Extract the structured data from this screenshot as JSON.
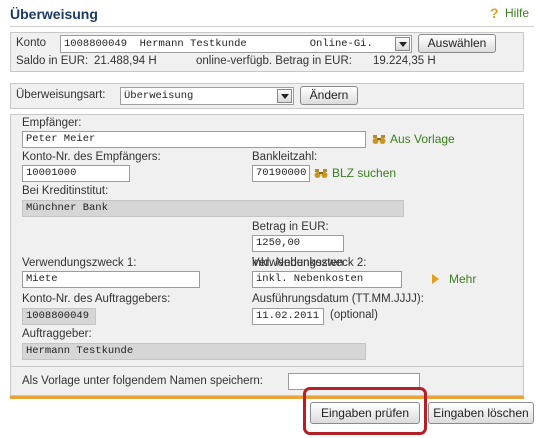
{
  "header": {
    "title": "Überweisung",
    "help_label": "Hilfe"
  },
  "account": {
    "label": "Konto",
    "select_value": "1008800049  Hermann Testkunde          Online-Gi.",
    "select_button": "Auswählen",
    "saldo_label": "Saldo in EUR:",
    "saldo_value": "21.488,94 H",
    "available_label": "online-verfügb. Betrag in EUR:",
    "available_value": "19.224,35 H"
  },
  "transfer_type": {
    "label": "Überweisungsart:",
    "value": "Überweisung",
    "change_button": "Ändern"
  },
  "form": {
    "recipient_label": "Empfänger:",
    "recipient_value": "Peter Meier",
    "template_link": "Aus Vorlage",
    "recipient_account_label": "Konto-Nr. des Empfängers:",
    "recipient_account_value": "10001000",
    "bank_code_label": "Bankleitzahl:",
    "bank_code_value": "70190000",
    "bank_code_search": "BLZ suchen",
    "institute_label": "Bei Kreditinstitut:",
    "institute_value": "Münchner Bank",
    "amount_label": "Betrag in EUR:",
    "amount_value": "1250,00",
    "purpose1_label": "Verwendungszweck 1:",
    "purpose1_value": "Miete",
    "purpose2_label": "Verwendungszweck 2:",
    "purpose2_value": "inkl. Nebenkosten",
    "more_link": "Mehr",
    "sender_account_label": "Konto-Nr. des Auftraggebers:",
    "sender_account_value": "1008800049",
    "execution_date_label": "Ausführungsdatum (TT.MM.JJJJ):",
    "execution_date_value": "11.02.2011",
    "optional_label": "(optional)",
    "sender_label": "Auftraggeber:",
    "sender_value": "Hermann Testkunde"
  },
  "save_template": {
    "label": "Als Vorlage unter folgendem Namen speichern:",
    "value": ""
  },
  "actions": {
    "check_button": "Eingaben prüfen",
    "clear_button": "Eingaben löschen"
  },
  "colors": {
    "title": "#1b3a66",
    "link": "#3a7f1e",
    "accent": "#e8a33a",
    "highlight": "#b32025"
  }
}
